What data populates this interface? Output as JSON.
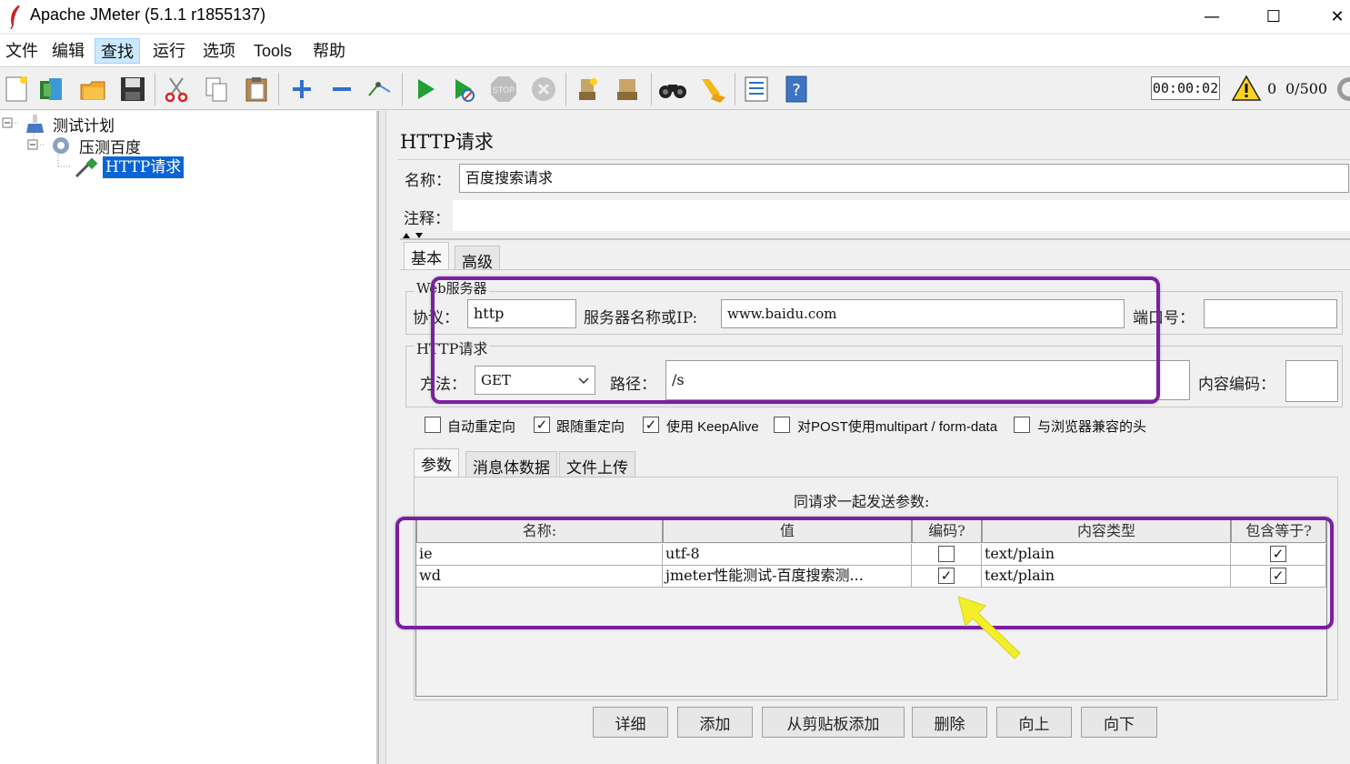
{
  "window": {
    "title": "Apache JMeter (5.1.1 r1855137)",
    "minimize": "—",
    "maximize": "☐",
    "close": "✕"
  },
  "menu": [
    "文件",
    "编辑",
    "查找",
    "运行",
    "选项",
    "Tools",
    "帮助"
  ],
  "toolbar": {
    "timer": "00:00:02",
    "warnings": "0",
    "threads": "0/500"
  },
  "toolbar_icons": [
    "new-icon",
    "templates-icon",
    "open-icon",
    "save-icon",
    "cut-icon",
    "copy-icon",
    "paste-icon",
    "expand-icon",
    "collapse-icon",
    "toggle-icon",
    "start-icon",
    "start-no-pause-icon",
    "stop-icon",
    "shutdown-icon",
    "clear-icon",
    "clear-all-icon",
    "search-icon",
    "reset-search-icon",
    "function-helper-icon",
    "help-icon"
  ],
  "tree": {
    "items": [
      {
        "label": "测试计划"
      },
      {
        "label": "压测百度"
      },
      {
        "label": "HTTP请求"
      }
    ]
  },
  "panel": {
    "title": "HTTP请求",
    "name_label": "名称：",
    "name_value": "百度搜索请求",
    "comment_label": "注释："
  },
  "tabs": [
    "基本",
    "高级"
  ],
  "web_server": {
    "group_title": "Web服务器",
    "protocol_label": "协议：",
    "protocol_value": "http",
    "server_label": "服务器名称或IP:",
    "server_value": "www.baidu.com",
    "port_label": "端口号："
  },
  "http_request": {
    "group_title": "HTTP请求",
    "method_label": "方法：",
    "method_value": "GET",
    "path_label": "路径：",
    "path_value": "/s",
    "encoding_label": "内容编码："
  },
  "checkboxes": [
    {
      "label": "自动重定向",
      "checked": false
    },
    {
      "label": "跟随重定向",
      "checked": true
    },
    {
      "label": "使用 KeepAlive",
      "checked": true
    },
    {
      "label": "对POST使用multipart / form-data",
      "checked": false
    },
    {
      "label": "与浏览器兼容的头",
      "checked": false
    }
  ],
  "sub_tabs": [
    "参数",
    "消息体数据",
    "文件上传"
  ],
  "params": {
    "caption": "同请求一起发送参数:",
    "headers": [
      "名称:",
      "值",
      "编码?",
      "内容类型",
      "包含等于?"
    ],
    "rows": [
      {
        "name": "ie",
        "value": "utf-8",
        "encode": false,
        "content_type": "text/plain",
        "include_equals": true
      },
      {
        "name": "wd",
        "value": "jmeter性能测试-百度搜索测...",
        "encode": true,
        "content_type": "text/plain",
        "include_equals": true
      }
    ]
  },
  "buttons": [
    "详细",
    "添加",
    "从剪贴板添加",
    "删除",
    "向上",
    "向下"
  ],
  "colors": {
    "highlight": "#7a1fa2",
    "arrow": "#f2ef2a",
    "selection": "#0a64d6"
  }
}
